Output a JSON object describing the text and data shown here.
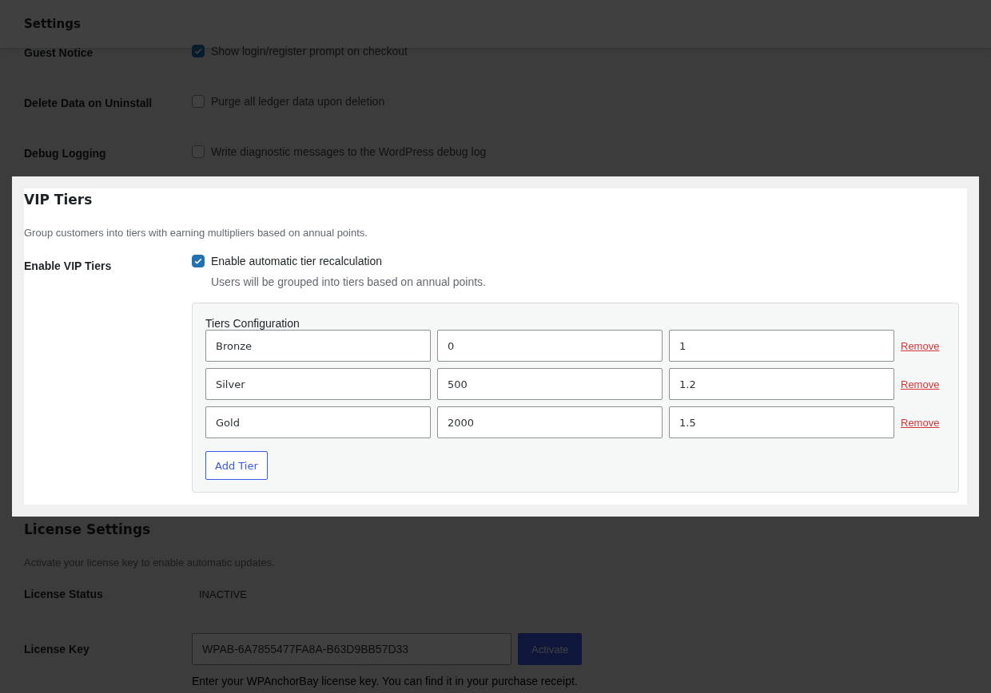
{
  "header": {
    "title": "Settings"
  },
  "general_rows": [
    {
      "label": "Guest Notice",
      "text": "Show login/register prompt on checkout",
      "checked": true
    },
    {
      "label": "Delete Data on Uninstall",
      "text": "Purge all ledger data upon deletion",
      "checked": false
    },
    {
      "label": "Debug Logging",
      "text": "Write diagnostic messages to the WordPress debug log",
      "checked": false
    }
  ],
  "vip_tiers": {
    "title": "VIP Tiers",
    "description": "Group customers into tiers with earning multipliers based on annual points.",
    "label": "Enable VIP Tiers",
    "checkbox_text": "Enable automatic tier recalculation",
    "checked": true,
    "hint": "Users will be grouped into tiers based on annual points.",
    "config_title": "Tiers Configuration",
    "tiers": [
      {
        "name": "Bronze",
        "points": "0",
        "multiplier": "1",
        "remove": "Remove"
      },
      {
        "name": "Silver",
        "points": "500",
        "multiplier": "1.2",
        "remove": "Remove"
      },
      {
        "name": "Gold",
        "points": "2000",
        "multiplier": "1.5",
        "remove": "Remove"
      }
    ],
    "add_button": "Add Tier"
  },
  "license": {
    "title": "License Settings",
    "description": "Activate your license key to enable automatic updates.",
    "status_label": "License Status",
    "status": "INACTIVE",
    "key_label": "License Key",
    "key": "WPAB-6A7855477FA8A-B63D9BB57D33",
    "activate_button": "Activate",
    "hint": "Enter your WPAnchorBay license key. You can find it in your purchase receipt."
  }
}
